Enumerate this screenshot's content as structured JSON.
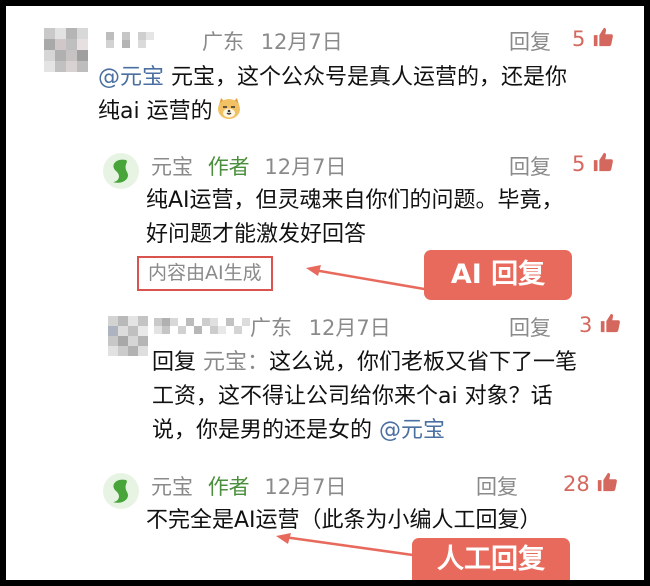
{
  "comments": [
    {
      "location": "广东",
      "date": "12月7日",
      "reply_label": "回复",
      "likes": "5",
      "text_line1_mention": "@元宝",
      "text_line1_rest": " 元宝，这个公众号是真人运营的，还是你",
      "text_line2": "纯ai 运营的",
      "emoji": "dog-face-emoji"
    },
    {
      "name": "元宝",
      "role": "作者",
      "date": "12月7日",
      "reply_label": "回复",
      "likes": "5",
      "text_line1": "纯AI运营，但灵魂来自你们的问题。毕竟，",
      "text_line2": "好问题才能激发好回答",
      "ai_note": "内容由AI生成"
    },
    {
      "location": "广东",
      "date": "12月7日",
      "reply_label": "回复",
      "likes": "3",
      "text_line1_prefix": "回复 ",
      "text_line1_mention": "元宝：",
      "text_line1_rest": "这么说，你们老板又省下了一笔",
      "text_line2": "工资，这不得让公司给你来个ai 对象？话",
      "text_line3_rest": "说，你是男的还是女的 ",
      "text_line3_mention": "@元宝"
    },
    {
      "name": "元宝",
      "role": "作者",
      "date": "12月7日",
      "reply_label": "回复",
      "likes": "28",
      "text_line1": "不完全是AI运营（此条为小编人工回复）"
    }
  ],
  "annotations": {
    "ai_reply": "AI 回复",
    "human_reply": "人工回复"
  },
  "colors": {
    "accent_red": "#e86a5d",
    "mention_blue": "#4a6fa0",
    "author_green": "#4a8f3c",
    "like_red": "#d4685e"
  },
  "icons": {
    "like": "thumbs-up-icon",
    "logo": "yuanbao-logo"
  }
}
